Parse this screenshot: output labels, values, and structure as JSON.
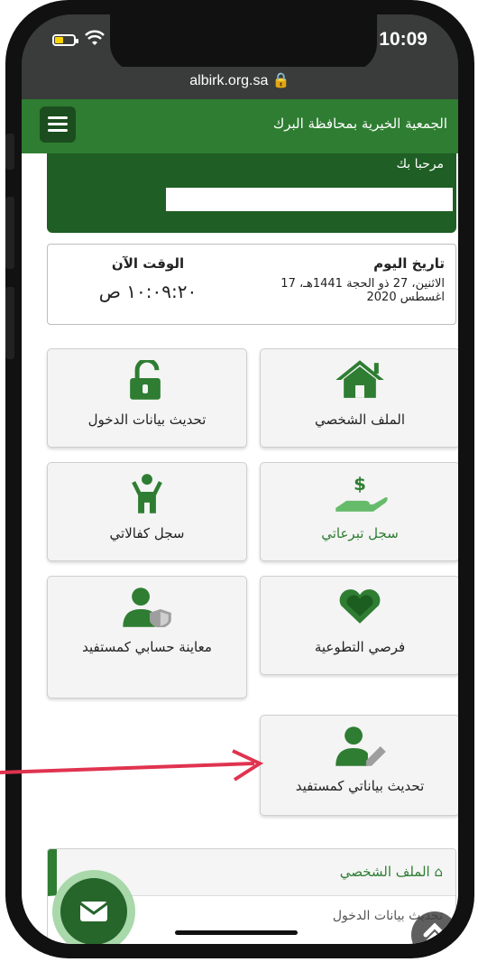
{
  "status_bar": {
    "time": "10:09"
  },
  "browser": {
    "url": "albirk.org.sa 🔒"
  },
  "app_bar": {
    "title": "الجمعية الخيرية بمحافظة البرك"
  },
  "welcome": {
    "greeting": "مرحبا بك"
  },
  "date_card": {
    "date_title": "تاريخ اليوم",
    "date_value": "الاثنين، 27 ذو الحجة 1441هـ، 17 اغسطس 2020",
    "time_title": "الوقت الآن",
    "time_value": "١٠:٠٩:٢٠ ص"
  },
  "tiles": [
    {
      "label": "الملف الشخصي",
      "icon": "home-icon"
    },
    {
      "label": "تحديث بيانات الدخول",
      "icon": "unlock-icon"
    },
    {
      "label": "سجل تبرعاتي",
      "icon": "donation-hand-icon",
      "highlight": true
    },
    {
      "label": "سجل كفالاتي",
      "icon": "child-icon"
    },
    {
      "label": "فرصي التطوعية",
      "icon": "heart-icon"
    },
    {
      "label": "معاينة حسابي كمستفيد",
      "icon": "user-shield-icon"
    },
    {
      "label": "تحديث بياناتي كمستفيد",
      "icon": "user-edit-icon"
    }
  ],
  "side_panel": {
    "heading": "الملف الشخصي",
    "item": "تحديث بيانات الدخول"
  },
  "colors": {
    "brand_green": "#2e7d32",
    "dark_green": "#1b5e20",
    "annotation_arrow": "#e0334f"
  }
}
